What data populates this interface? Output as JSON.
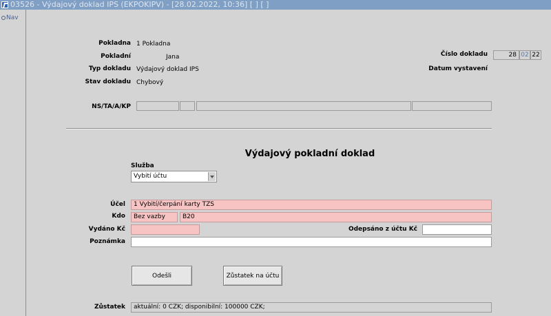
{
  "window": {
    "title": "03526 - Výdajový doklad IPS (EKPOKIPV) - [28.02.2022, 10:36]  [ ]  [ ]"
  },
  "nav": {
    "label": "Nav"
  },
  "header": {
    "pokladna_label": "Pokladna",
    "pokladna_value": "1 Pokladna",
    "pokladni_label": "Pokladní",
    "pokladni_value": "Jana",
    "typ_label": "Typ dokladu",
    "typ_value": "Výdajový doklad IPS",
    "stav_label": "Stav dokladu",
    "stav_value": "Chybový",
    "cislo_label": "Číslo dokladu",
    "cislo_1": "28",
    "cislo_2": "02",
    "cislo_3": "22",
    "datum_label": "Datum vystavení",
    "ns_label": "NS/TA/A/KP",
    "ns_1": "",
    "ns_2": "",
    "ns_3": "",
    "ns_4": ""
  },
  "form": {
    "title": "Výdajový pokladní doklad",
    "sluzba_label": "Služba",
    "sluzba_value": "Vybití účtu",
    "ucel_label": "Účel",
    "ucel_value": "1 Vybití/čerpání karty TZS",
    "kdo_label": "Kdo",
    "kdo_value_1": "Bez vazby",
    "kdo_value_2": "B20",
    "vydano_label": "Vydáno Kč",
    "vydano_value": "",
    "odepsano_label": "Odepsáno z účtu Kč",
    "odepsano_value": "",
    "poznamka_label": "Poznámka",
    "poznamka_value": "",
    "zustatek_label": "Zůstatek",
    "zustatek_value": "aktuální: 0 CZK; disponibilní: 100000 CZK;"
  },
  "buttons": {
    "odesli": "Odešli",
    "zustatek": "Zůstatek na účtu"
  },
  "colors": {
    "titlebar": "#7f9fc4",
    "background": "#d4d4d4",
    "required_field": "#f7c3c3"
  }
}
